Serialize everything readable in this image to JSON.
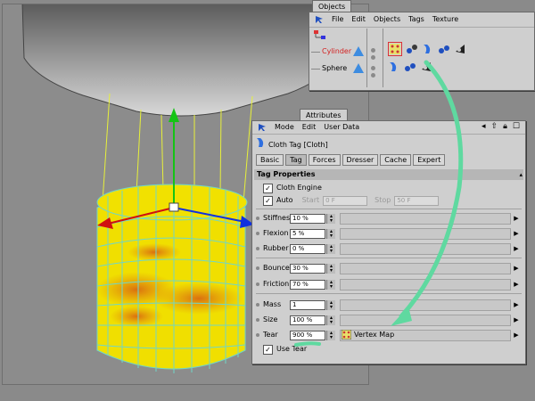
{
  "objects_panel": {
    "tab_label": "Objects",
    "menu": [
      "File",
      "Edit",
      "Objects",
      "Tags",
      "Texture"
    ],
    "objects": [
      {
        "name": "Cylinder",
        "color": "#d32020"
      },
      {
        "name": "Sphere",
        "color": "#000000"
      }
    ]
  },
  "attributes_panel": {
    "tab_label": "Attributes",
    "menu": [
      "Mode",
      "Edit",
      "User Data"
    ],
    "tag_title": "Cloth Tag [Cloth]",
    "tabs": [
      "Basic",
      "Tag",
      "Forces",
      "Dresser",
      "Cache",
      "Expert"
    ],
    "active_tab": "Tag",
    "section_header": "Tag Properties",
    "cloth_engine": {
      "label": "Cloth Engine",
      "checked": "✓"
    },
    "auto": {
      "label": "Auto",
      "checked": "✓",
      "start_label": "Start",
      "start_value": "0 F",
      "stop_label": "Stop",
      "stop_value": "50 F"
    },
    "properties": [
      {
        "label": "Stiffness",
        "value": "10 %"
      },
      {
        "label": "Flexion",
        "value": "5 %"
      },
      {
        "label": "Rubber",
        "value": "0 %"
      },
      {
        "label": "Bounce",
        "value": "30 %"
      },
      {
        "label": "Friction",
        "value": "70 %"
      },
      {
        "label": "Mass",
        "value": "1"
      },
      {
        "label": "Size",
        "value": "100 %"
      },
      {
        "label": "Tear",
        "value": "900 %"
      }
    ],
    "vertex_map_label": "Vertex Map",
    "use_tear": {
      "label": "Use Tear",
      "checked": "✓"
    }
  },
  "colors": {
    "panel_bg": "#cfcfcf",
    "viewport_bg": "#8c8c8c",
    "annotation_arrow": "#5fd9a0",
    "cylinder_yellow": "#f2e200",
    "cylinder_orange": "#e07a10",
    "mesh_edges": "#6fd6c9"
  },
  "icons": [
    "axis-arrow-icon",
    "cloth-tag-icon",
    "object-icon",
    "tag-icon",
    "vertex-map-icon",
    "lock-icon",
    "up-arrow-icon",
    "settings-icon",
    "expand-arrow-icon"
  ]
}
